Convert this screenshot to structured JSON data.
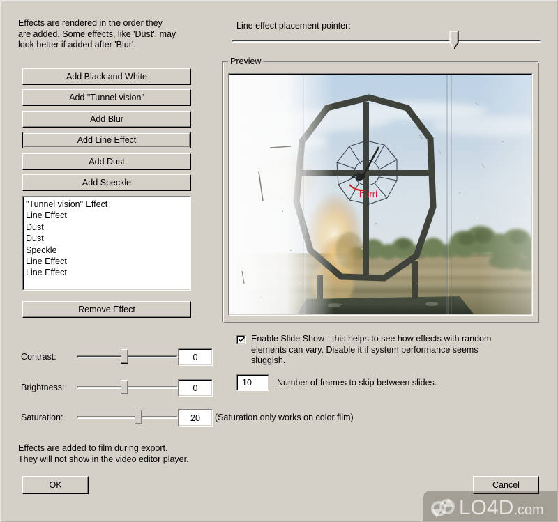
{
  "dialog": {
    "intro_text": "Effects are rendered in the order they\nare added.  Some effects, like 'Dust', may\nlook better if added after 'Blur'.",
    "footer_note": "Effects are added to film during export.\nThey will not show in the video editor player.",
    "ok_label": "OK",
    "cancel_label": "Cancel"
  },
  "effect_buttons": [
    {
      "label": "Add Black and White",
      "name": "add-black-and-white-button",
      "default": false
    },
    {
      "label": "Add \"Tunnel vision\"",
      "name": "add-tunnel-vision-button",
      "default": false
    },
    {
      "label": "Add Blur",
      "name": "add-blur-button",
      "default": false
    },
    {
      "label": "Add Line Effect",
      "name": "add-line-effect-button",
      "default": true
    },
    {
      "label": "Add Dust",
      "name": "add-dust-button",
      "default": false
    },
    {
      "label": "Add Speckle",
      "name": "add-speckle-button",
      "default": false
    }
  ],
  "effect_list": {
    "items": [
      "\"Tunnel vision\" Effect",
      "Line Effect",
      "Dust",
      "Dust",
      "Speckle",
      "Line Effect",
      "Line Effect"
    ],
    "remove_label": "Remove Effect"
  },
  "pointer": {
    "label": "Line effect placement pointer:",
    "value_percent": 73
  },
  "preview": {
    "group_label": "Preview",
    "reticle_label": "hurri"
  },
  "slide_show": {
    "checkbox_label": "Enable Slide Show - this helps to see how effects with random\nelements can vary.  Disable it if system performance seems\nsluggish.",
    "checked": true,
    "frames_value": "10",
    "frames_label": "Number of frames to skip between slides."
  },
  "adjustments": [
    {
      "label": "Contrast:",
      "value": "0",
      "percent": 47,
      "name": "contrast"
    },
    {
      "label": "Brightness:",
      "value": "0",
      "percent": 47,
      "name": "brightness"
    },
    {
      "label": "Saturation:",
      "value": "20",
      "percent": 62,
      "name": "saturation"
    }
  ],
  "saturation_note": "(Saturation only works on color film)",
  "watermark": {
    "brand": "LO4D",
    "domain": ".com"
  },
  "colors": {
    "face": "#d4d0c8",
    "shadow": "#808080",
    "highlight": "#ffffff",
    "field": "#ffffff",
    "text": "#000000",
    "reticle_label": "#cc2222"
  }
}
